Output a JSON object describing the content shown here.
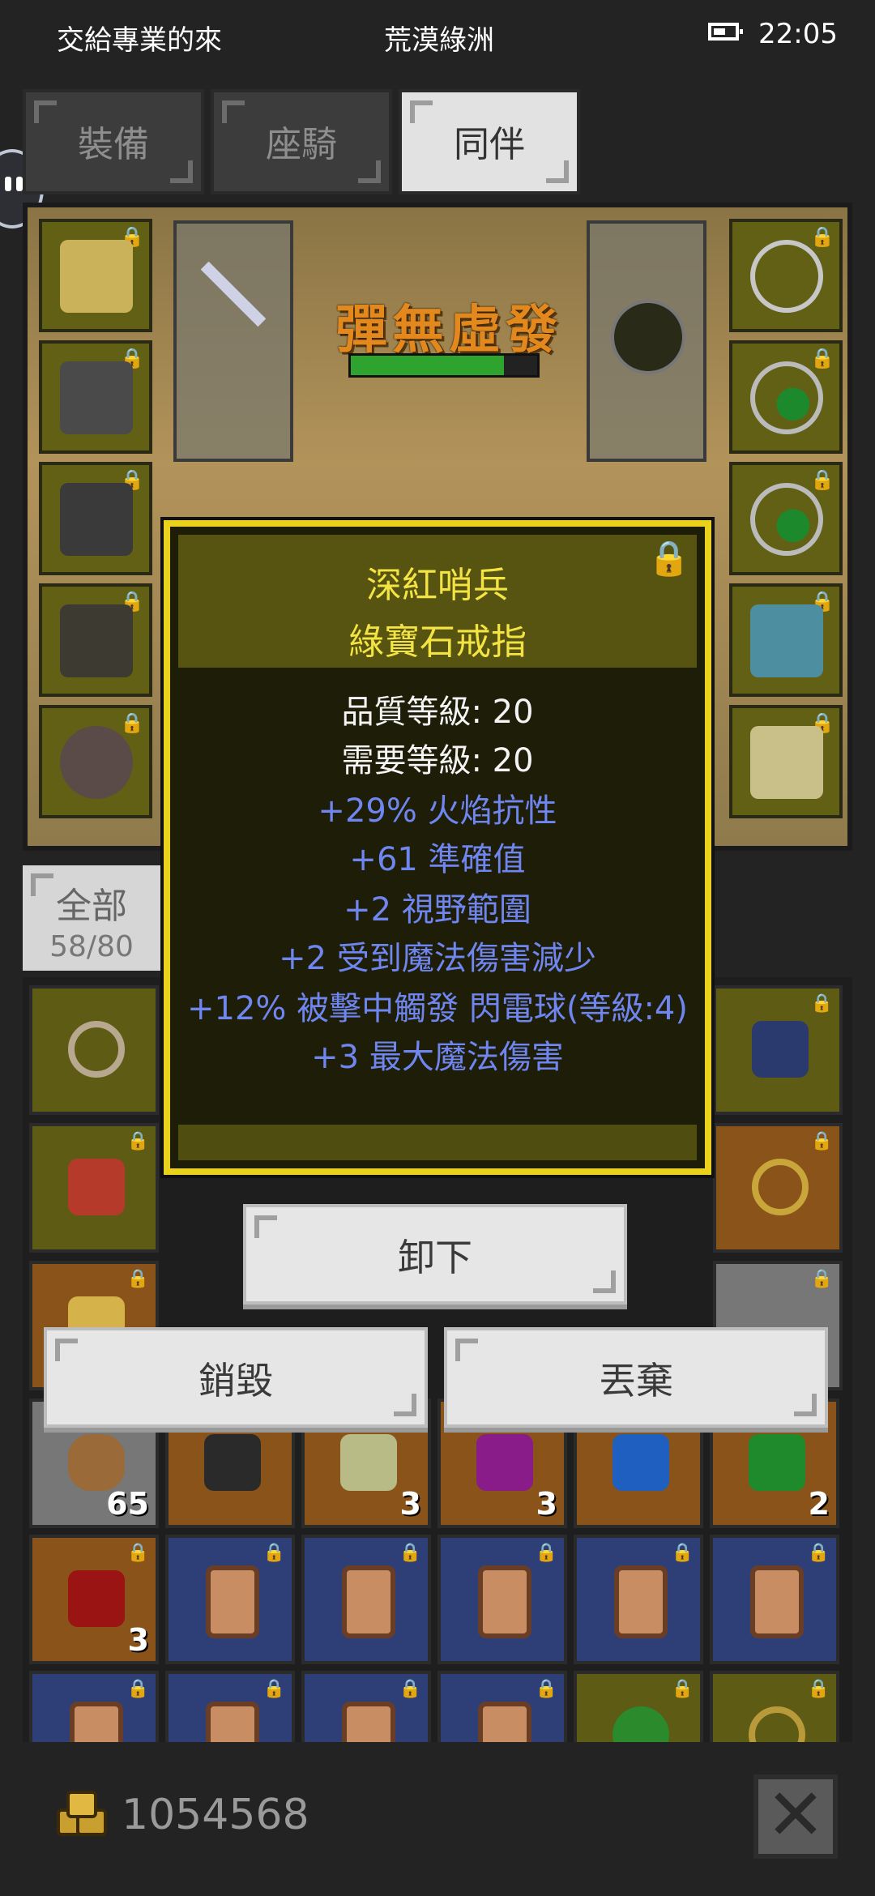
{
  "status_bar": {
    "left_text": "交給專業的來",
    "center_text": "荒漠綠洲",
    "time": "22:05"
  },
  "tabs": [
    {
      "label": "裝備",
      "active": false
    },
    {
      "label": "座騎",
      "active": false
    },
    {
      "label": "同伴",
      "active": true
    }
  ],
  "scene": {
    "banner_text": "彈無虛發",
    "hp_fraction": 0.82
  },
  "bag": {
    "tab_label": "全部",
    "count": "58/80",
    "quantities": {
      "ore": "65",
      "gem_beige": "3",
      "gem_purple": "3",
      "gem_green": "2",
      "gem_red": "3"
    }
  },
  "tooltip": {
    "subtitle": "深紅哨兵",
    "item_name": "綠寶石戒指",
    "quality": "品質等級: 20",
    "required_level": "需要等級: 20",
    "bonuses": [
      "+29% 火焰抗性",
      "+61 準確值",
      "+2 視野範圍",
      "+2 受到魔法傷害減少",
      "+12% 被擊中觸發 閃電球(等級:4)",
      "+3 最大魔法傷害"
    ]
  },
  "actions": {
    "unequip": "卸下",
    "destroy": "銷毀",
    "discard": "丟棄"
  },
  "footer": {
    "gold": "1054568"
  },
  "colors": {
    "tooltip_border": "#e8d21c",
    "tooltip_title": "#f4e443",
    "bonus_text": "#6f86f0"
  }
}
